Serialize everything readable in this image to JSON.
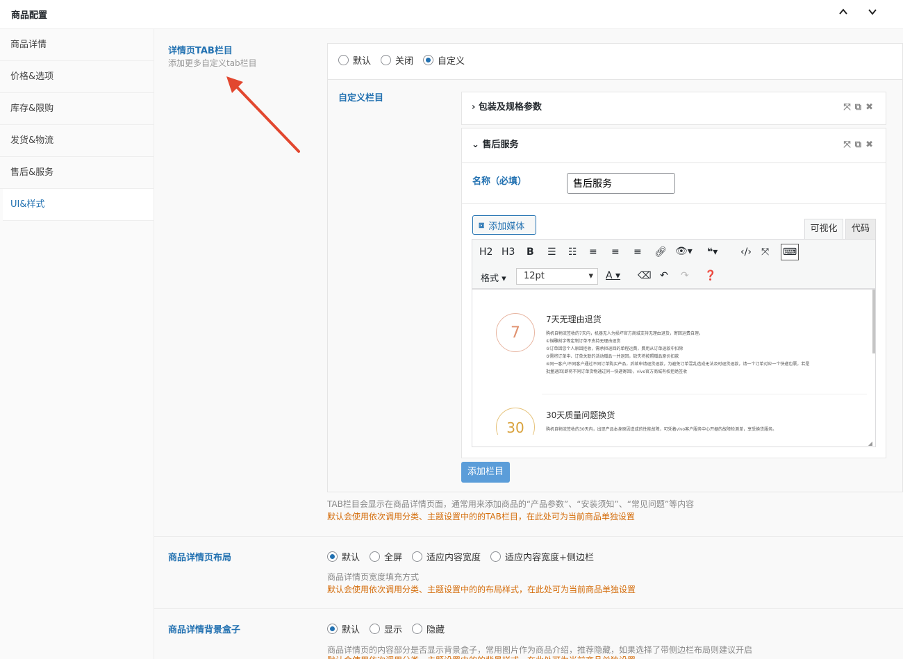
{
  "header": {
    "title": "商品配置",
    "up_icon": "chevron-up-icon",
    "down_icon": "chevron-down-icon"
  },
  "sidebar": {
    "items": [
      {
        "label": "商品详情"
      },
      {
        "label": "价格&选项"
      },
      {
        "label": "库存&限购"
      },
      {
        "label": "发货&物流"
      },
      {
        "label": "售后&服务"
      },
      {
        "label": "UI&样式"
      }
    ],
    "active_index": 5
  },
  "tab_section": {
    "label": "详情页TAB栏目",
    "sublabel": "添加更多自定义tab栏目",
    "options": [
      "默认",
      "关闭",
      "自定义"
    ],
    "selected": "自定义",
    "custom_label": "自定义栏目",
    "panels": [
      {
        "title": "包装及规格参数",
        "expanded": false
      },
      {
        "title": "售后服务",
        "expanded": true
      }
    ],
    "name_label": "名称（必填）",
    "name_value": "售后服务",
    "add_media": "添加媒体",
    "tab_visual": "可视化",
    "tab_code": "代码",
    "toolbar_h2": "H2",
    "toolbar_h3": "H3",
    "toolbar_bold": "B",
    "format_label": "格式",
    "font_size": "12pt",
    "editor_content": {
      "block1_title": "7天无理由退货",
      "block1_lines": [
        "购机自物流签收的7天内，机器无人为损坏官方商城支持无理由退货，寄回运费自理。",
        "①锚雕刻字等定制订单不支持无理由退货",
        "②订单因您个人原因拒收，需承担退回的单程运费，费用从订单退款中扣除",
        "③需将订单中、订单关联的活动赠品一并退回，缺失将按照赠品原价扣款",
        "④同一客户/不同客户通过不同订单购买产品，后续申请退货退款，为避免订单混乱造成无法及时退货退款，请一个订单对应一个快递包裹，若是",
        "批量退回(即将不同订单货物通过同一快递寄回)，vivo官方商城有权拒绝签收"
      ],
      "block1_icon": "7",
      "block2_title": "30天质量问题换货",
      "block2_lines": [
        "购机自物流签收的30天内，出现产品本身原因造成的性能故障，可凭着vivo客户服务中心开据的故障检测单，享受换货服务。"
      ],
      "block2_icon": "30"
    },
    "add_button": "添加栏目",
    "desc": "TAB栏目会显示在商品详情页面，通常用来添加商品的“产品参数”、“安装须知”、“常见问题”等内容",
    "warn": "默认会使用依次调用分类、主题设置中的的TAB栏目，在此处可为当前商品单独设置"
  },
  "layout_section": {
    "label": "商品详情页布局",
    "options": [
      "默认",
      "全屏",
      "适应内容宽度",
      "适应内容宽度+侧边栏"
    ],
    "selected": "默认",
    "desc": "商品详情页宽度填充方式",
    "warn": "默认会使用依次调用分类、主题设置中的的布局样式，在此处可为当前商品单独设置"
  },
  "bg_section": {
    "label": "商品详情背景盒子",
    "options": [
      "默认",
      "显示",
      "隐藏"
    ],
    "selected": "默认",
    "desc": "商品详情页的内容部分是否显示背景盒子，常用图片作为商品介绍，推荐隐藏，如果选择了带侧边栏布局则建议开启",
    "warn": "默认会使用依次调用分类、主题设置中的的背景样式，在此处可为当前商品单独设置"
  },
  "colors": {
    "accent": "#2271b1",
    "warn": "#d46b08",
    "arrow": "#e2472f"
  }
}
